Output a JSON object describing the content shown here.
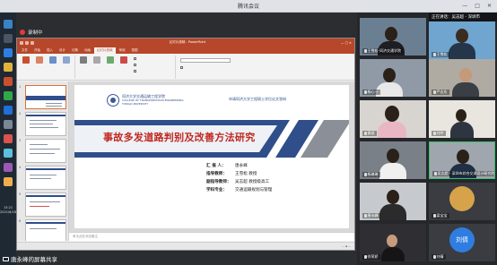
{
  "app": {
    "title": "腾讯会议"
  },
  "recording": {
    "label": "录制中"
  },
  "taskbar": {
    "time": "13:21",
    "date": "2021/6/18"
  },
  "powerpoint": {
    "window_title": "幻灯片放映 - PowerPoint",
    "tabs": [
      "文件",
      "开始",
      "插入",
      "设计",
      "切换",
      "动画",
      "幻灯片放映",
      "审阅",
      "视图"
    ],
    "active_tab": "幻灯片放映",
    "notes_placeholder": "单击此处添加备注",
    "thumbnail_numbers": [
      "1",
      "2",
      "3",
      "4",
      "5",
      "6"
    ],
    "slide": {
      "college_cn": "同济大学交通运输工程学院",
      "college_en_1": "COLLEGE OF TRANSPORTATION ENGINEERING",
      "college_en_2": "TONGJI UNIVERSITY",
      "header": "申请同济大学工程硕士学位论文答辩",
      "title": "事故多发道路判别及改善方法研究",
      "info": [
        {
          "k": "汇 报 人：",
          "v": "唐永峰"
        },
        {
          "k": "指导教师：",
          "v": "王雪松 教授"
        },
        {
          "k": "副指导教师：",
          "v": "吴志超 教授级高工"
        },
        {
          "k": "学科专业：",
          "v": "交通运输规划与管理"
        }
      ]
    }
  },
  "share_label": "唐永峰的屏幕共享",
  "speaking": "正在讲话：吴志超 - 深圳市",
  "participants": [
    {
      "name": "王雪松-同济交通学院"
    },
    {
      "name": "王雪松"
    },
    {
      "name": "杨心一"
    },
    {
      "name": "严志东"
    },
    {
      "name": "黄斌"
    },
    {
      "name": "刘中"
    },
    {
      "name": "杨琳琳"
    },
    {
      "name": "吴志超 - 深圳市综合交通设计研究院"
    },
    {
      "name": "唐永峰"
    },
    {
      "name": "梁宝宝"
    },
    {
      "name": "徐荣娇"
    },
    {
      "name": "刘倩",
      "avatar_text": "刘倩"
    }
  ],
  "colors": {
    "ppt_accent": "#b7472a",
    "slide_band_navy": "#2f4e8a",
    "slide_title_red": "#c0281f",
    "avatar_blue": "#2f7de1",
    "recording_red": "#e03b3b"
  }
}
